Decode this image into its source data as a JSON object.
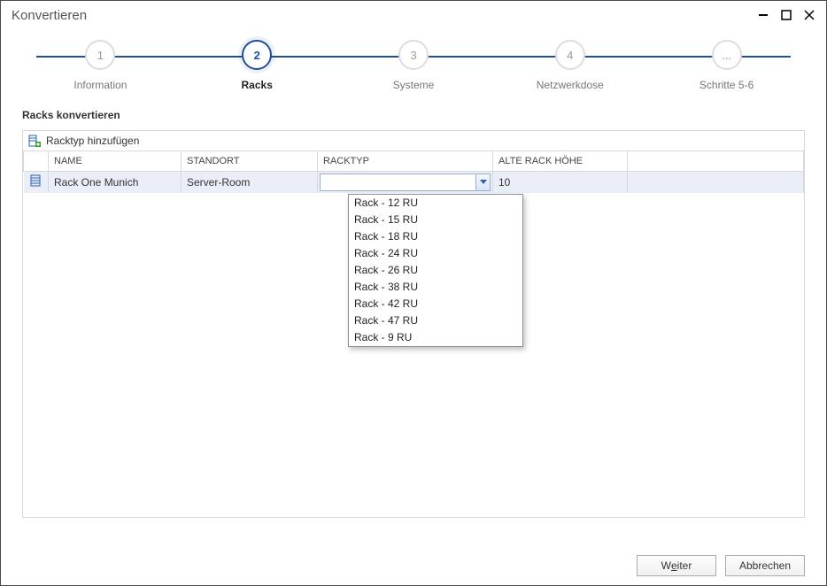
{
  "window": {
    "title": "Konvertieren"
  },
  "steps": [
    {
      "num": "1",
      "label": "Information"
    },
    {
      "num": "2",
      "label": "Racks"
    },
    {
      "num": "3",
      "label": "Systeme"
    },
    {
      "num": "4",
      "label": "Netzwerkdose"
    },
    {
      "num": "...",
      "label": "Schritte 5-6"
    }
  ],
  "active_step_index": 1,
  "section": {
    "title": "Racks konvertieren"
  },
  "toolbar": {
    "add_racktype": "Racktyp hinzufügen"
  },
  "columns": {
    "name": "NAME",
    "standort": "STANDORT",
    "racktyp": "RACKTYP",
    "alte_hoehe": "ALTE RACK HÖHE"
  },
  "rows": [
    {
      "name": "Rack One Munich",
      "standort": "Server-Room",
      "racktyp": "",
      "alte_hoehe": "10"
    }
  ],
  "racktyp_options": [
    "Rack - 12 RU",
    "Rack - 15 RU",
    "Rack - 18 RU",
    "Rack - 24 RU",
    "Rack - 26 RU",
    "Rack - 38 RU",
    "Rack - 42 RU",
    "Rack - 47 RU",
    "Rack - 9 RU"
  ],
  "buttons": {
    "next_pre": "W",
    "next_u": "e",
    "next_post": "iter",
    "cancel": "Abbrechen"
  }
}
